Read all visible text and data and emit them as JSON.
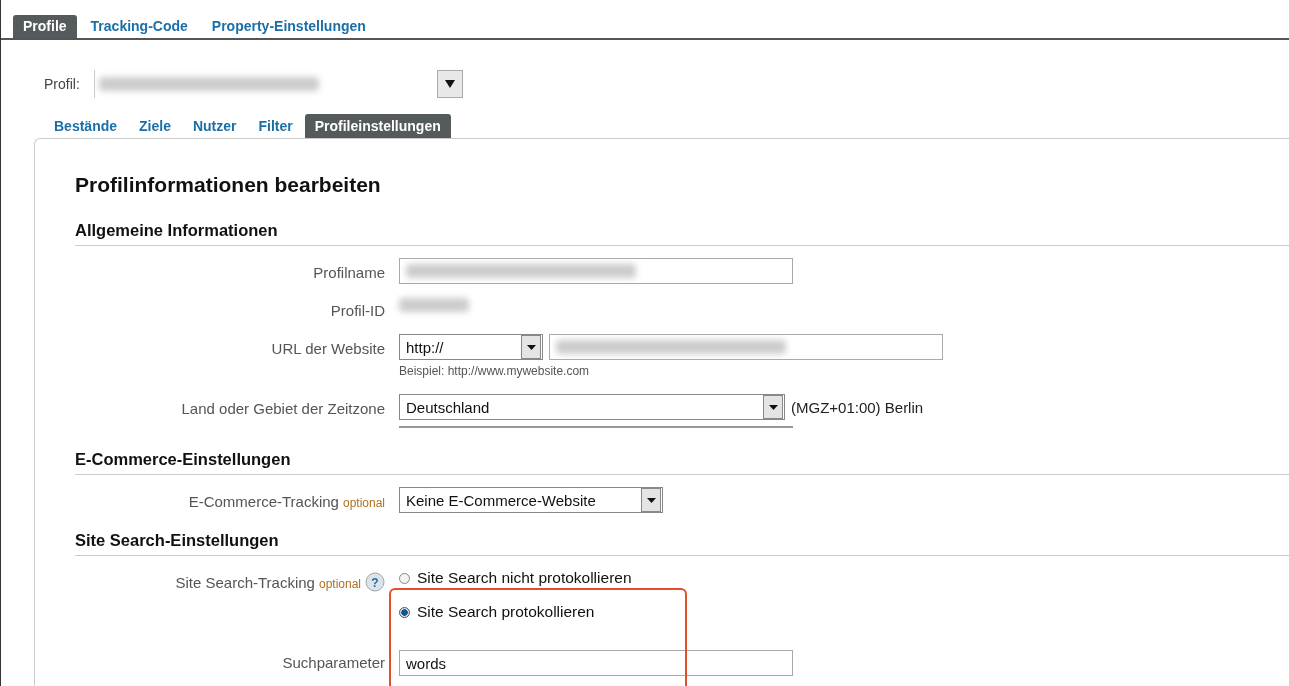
{
  "top_tabs": [
    {
      "label": "Profile",
      "selected": true
    },
    {
      "label": "Tracking-Code",
      "selected": false
    },
    {
      "label": "Property-Einstellungen",
      "selected": false
    }
  ],
  "profile_selector": {
    "label": "Profil:"
  },
  "sub_tabs": [
    {
      "label": "Bestände",
      "selected": false
    },
    {
      "label": "Ziele",
      "selected": false
    },
    {
      "label": "Nutzer",
      "selected": false
    },
    {
      "label": "Filter",
      "selected": false
    },
    {
      "label": "Profileinstellungen",
      "selected": true
    }
  ],
  "page_title": "Profilinformationen bearbeiten",
  "sections": [
    {
      "title": "Allgemeine Informationen",
      "rows": [
        {
          "kind": "redacted-input",
          "label": "Profilname"
        },
        {
          "kind": "redacted-text",
          "label": "Profil-ID"
        },
        {
          "kind": "url",
          "label": "URL der Website",
          "protocol": "http://",
          "hint": "Beispiel: http://www.mywebsite.com"
        },
        {
          "kind": "select",
          "label": "Land oder Gebiet der Zeitzone",
          "value": "Deutschland",
          "suffix": "(MGZ+01:00) Berlin",
          "cut_field": true
        }
      ]
    },
    {
      "title": "E-Commerce-Einstellungen",
      "rows": [
        {
          "kind": "small-select",
          "label": "E-Commerce-Tracking",
          "optional": "optional",
          "value": "Keine E-Commerce-Website"
        }
      ]
    },
    {
      "title": "Site Search-Einstellungen",
      "rows": [
        {
          "kind": "radios",
          "label": "Site Search-Tracking",
          "optional": "optional",
          "help": "?",
          "options": [
            {
              "label": "Site Search nicht protokollieren",
              "selected": false
            },
            {
              "label": "Site Search protokollieren",
              "selected": true
            }
          ]
        },
        {
          "kind": "input",
          "label": "Suchparameter",
          "value": "words"
        }
      ]
    }
  ]
}
